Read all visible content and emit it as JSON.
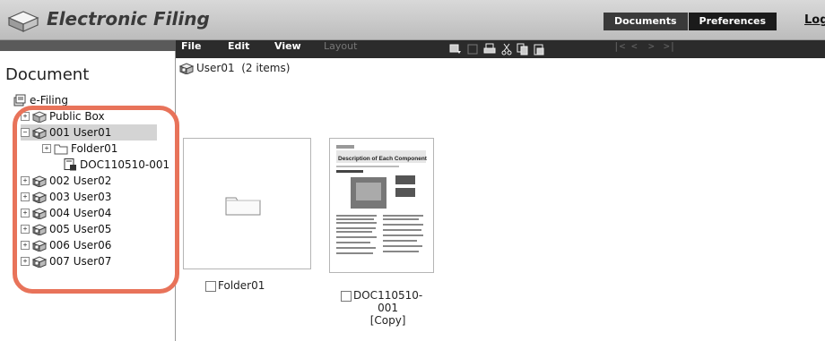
{
  "app": {
    "title": "Electronic Filing",
    "tabs": [
      {
        "label": "Documents"
      },
      {
        "label": "Preferences"
      }
    ],
    "login_label": "Logi"
  },
  "menu": {
    "items": [
      {
        "label": "File",
        "enabled": true
      },
      {
        "label": "Edit",
        "enabled": true
      },
      {
        "label": "View",
        "enabled": true
      },
      {
        "label": "Layout",
        "enabled": false
      }
    ],
    "nav_arrows": [
      "|<",
      "<",
      ">",
      ">|"
    ]
  },
  "sidebar": {
    "title": "Document",
    "tree": [
      {
        "label": "e-Filing",
        "icon": "efiling-icon"
      },
      {
        "label": "Public Box",
        "icon": "box-icon"
      },
      {
        "label": "001 User01",
        "icon": "user-box-icon",
        "selected": true
      },
      {
        "label": "Folder01",
        "icon": "folder-icon"
      },
      {
        "label": "DOC110510-001",
        "icon": "document-icon"
      },
      {
        "label": "002 User02",
        "icon": "user-box-icon"
      },
      {
        "label": "003 User03",
        "icon": "user-box-icon"
      },
      {
        "label": "004 User04",
        "icon": "user-box-icon"
      },
      {
        "label": "005 User05",
        "icon": "user-box-icon"
      },
      {
        "label": "006 User06",
        "icon": "user-box-icon"
      },
      {
        "label": "007 User07",
        "icon": "user-box-icon"
      }
    ]
  },
  "content": {
    "path": "User01  (2 items)",
    "items": [
      {
        "name": "Folder01",
        "type": "folder"
      },
      {
        "name_lines": [
          "DOC110510-",
          "001",
          "[Copy]"
        ],
        "type": "document"
      }
    ],
    "thumbnail": {
      "heading": "Description of Each Component"
    }
  },
  "colors": {
    "highlight": "#e8735a",
    "menubar": "#2b2b2b",
    "tab_bg": "#1b1b1b"
  }
}
